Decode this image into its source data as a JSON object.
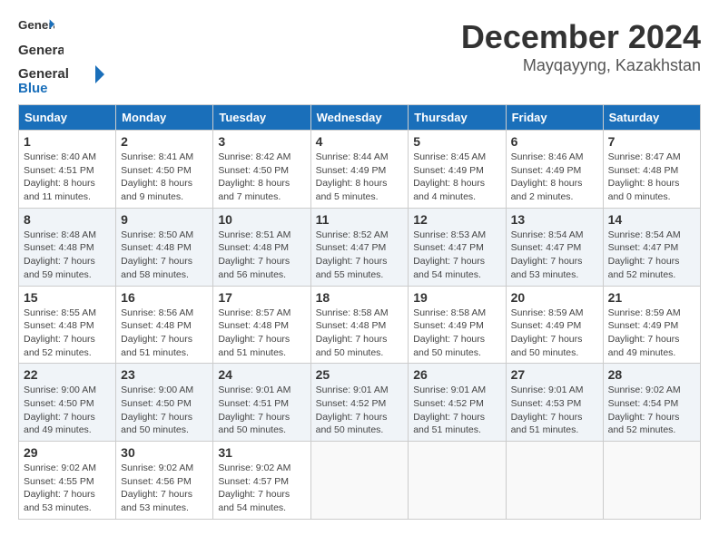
{
  "header": {
    "logo_general": "General",
    "logo_blue": "Blue",
    "month_title": "December 2024",
    "location": "Mayqayyng, Kazakhstan"
  },
  "weekdays": [
    "Sunday",
    "Monday",
    "Tuesday",
    "Wednesday",
    "Thursday",
    "Friday",
    "Saturday"
  ],
  "weeks": [
    [
      {
        "day": "1",
        "sunrise": "Sunrise: 8:40 AM",
        "sunset": "Sunset: 4:51 PM",
        "daylight": "Daylight: 8 hours and 11 minutes."
      },
      {
        "day": "2",
        "sunrise": "Sunrise: 8:41 AM",
        "sunset": "Sunset: 4:50 PM",
        "daylight": "Daylight: 8 hours and 9 minutes."
      },
      {
        "day": "3",
        "sunrise": "Sunrise: 8:42 AM",
        "sunset": "Sunset: 4:50 PM",
        "daylight": "Daylight: 8 hours and 7 minutes."
      },
      {
        "day": "4",
        "sunrise": "Sunrise: 8:44 AM",
        "sunset": "Sunset: 4:49 PM",
        "daylight": "Daylight: 8 hours and 5 minutes."
      },
      {
        "day": "5",
        "sunrise": "Sunrise: 8:45 AM",
        "sunset": "Sunset: 4:49 PM",
        "daylight": "Daylight: 8 hours and 4 minutes."
      },
      {
        "day": "6",
        "sunrise": "Sunrise: 8:46 AM",
        "sunset": "Sunset: 4:49 PM",
        "daylight": "Daylight: 8 hours and 2 minutes."
      },
      {
        "day": "7",
        "sunrise": "Sunrise: 8:47 AM",
        "sunset": "Sunset: 4:48 PM",
        "daylight": "Daylight: 8 hours and 0 minutes."
      }
    ],
    [
      {
        "day": "8",
        "sunrise": "Sunrise: 8:48 AM",
        "sunset": "Sunset: 4:48 PM",
        "daylight": "Daylight: 7 hours and 59 minutes."
      },
      {
        "day": "9",
        "sunrise": "Sunrise: 8:50 AM",
        "sunset": "Sunset: 4:48 PM",
        "daylight": "Daylight: 7 hours and 58 minutes."
      },
      {
        "day": "10",
        "sunrise": "Sunrise: 8:51 AM",
        "sunset": "Sunset: 4:48 PM",
        "daylight": "Daylight: 7 hours and 56 minutes."
      },
      {
        "day": "11",
        "sunrise": "Sunrise: 8:52 AM",
        "sunset": "Sunset: 4:47 PM",
        "daylight": "Daylight: 7 hours and 55 minutes."
      },
      {
        "day": "12",
        "sunrise": "Sunrise: 8:53 AM",
        "sunset": "Sunset: 4:47 PM",
        "daylight": "Daylight: 7 hours and 54 minutes."
      },
      {
        "day": "13",
        "sunrise": "Sunrise: 8:54 AM",
        "sunset": "Sunset: 4:47 PM",
        "daylight": "Daylight: 7 hours and 53 minutes."
      },
      {
        "day": "14",
        "sunrise": "Sunrise: 8:54 AM",
        "sunset": "Sunset: 4:47 PM",
        "daylight": "Daylight: 7 hours and 52 minutes."
      }
    ],
    [
      {
        "day": "15",
        "sunrise": "Sunrise: 8:55 AM",
        "sunset": "Sunset: 4:48 PM",
        "daylight": "Daylight: 7 hours and 52 minutes."
      },
      {
        "day": "16",
        "sunrise": "Sunrise: 8:56 AM",
        "sunset": "Sunset: 4:48 PM",
        "daylight": "Daylight: 7 hours and 51 minutes."
      },
      {
        "day": "17",
        "sunrise": "Sunrise: 8:57 AM",
        "sunset": "Sunset: 4:48 PM",
        "daylight": "Daylight: 7 hours and 51 minutes."
      },
      {
        "day": "18",
        "sunrise": "Sunrise: 8:58 AM",
        "sunset": "Sunset: 4:48 PM",
        "daylight": "Daylight: 7 hours and 50 minutes."
      },
      {
        "day": "19",
        "sunrise": "Sunrise: 8:58 AM",
        "sunset": "Sunset: 4:49 PM",
        "daylight": "Daylight: 7 hours and 50 minutes."
      },
      {
        "day": "20",
        "sunrise": "Sunrise: 8:59 AM",
        "sunset": "Sunset: 4:49 PM",
        "daylight": "Daylight: 7 hours and 50 minutes."
      },
      {
        "day": "21",
        "sunrise": "Sunrise: 8:59 AM",
        "sunset": "Sunset: 4:49 PM",
        "daylight": "Daylight: 7 hours and 49 minutes."
      }
    ],
    [
      {
        "day": "22",
        "sunrise": "Sunrise: 9:00 AM",
        "sunset": "Sunset: 4:50 PM",
        "daylight": "Daylight: 7 hours and 49 minutes."
      },
      {
        "day": "23",
        "sunrise": "Sunrise: 9:00 AM",
        "sunset": "Sunset: 4:50 PM",
        "daylight": "Daylight: 7 hours and 50 minutes."
      },
      {
        "day": "24",
        "sunrise": "Sunrise: 9:01 AM",
        "sunset": "Sunset: 4:51 PM",
        "daylight": "Daylight: 7 hours and 50 minutes."
      },
      {
        "day": "25",
        "sunrise": "Sunrise: 9:01 AM",
        "sunset": "Sunset: 4:52 PM",
        "daylight": "Daylight: 7 hours and 50 minutes."
      },
      {
        "day": "26",
        "sunrise": "Sunrise: 9:01 AM",
        "sunset": "Sunset: 4:52 PM",
        "daylight": "Daylight: 7 hours and 51 minutes."
      },
      {
        "day": "27",
        "sunrise": "Sunrise: 9:01 AM",
        "sunset": "Sunset: 4:53 PM",
        "daylight": "Daylight: 7 hours and 51 minutes."
      },
      {
        "day": "28",
        "sunrise": "Sunrise: 9:02 AM",
        "sunset": "Sunset: 4:54 PM",
        "daylight": "Daylight: 7 hours and 52 minutes."
      }
    ],
    [
      {
        "day": "29",
        "sunrise": "Sunrise: 9:02 AM",
        "sunset": "Sunset: 4:55 PM",
        "daylight": "Daylight: 7 hours and 53 minutes."
      },
      {
        "day": "30",
        "sunrise": "Sunrise: 9:02 AM",
        "sunset": "Sunset: 4:56 PM",
        "daylight": "Daylight: 7 hours and 53 minutes."
      },
      {
        "day": "31",
        "sunrise": "Sunrise: 9:02 AM",
        "sunset": "Sunset: 4:57 PM",
        "daylight": "Daylight: 7 hours and 54 minutes."
      },
      null,
      null,
      null,
      null
    ]
  ]
}
